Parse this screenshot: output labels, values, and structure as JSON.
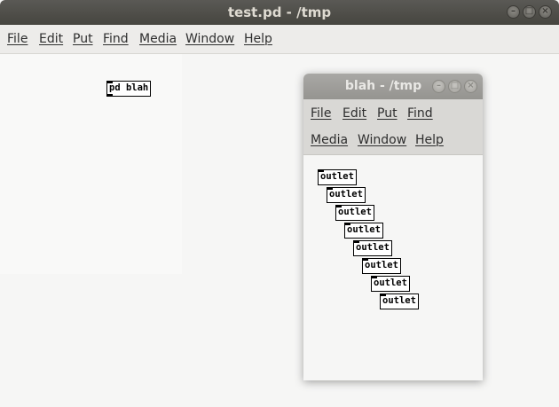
{
  "main_window": {
    "title": "test.pd  - /tmp",
    "controls": {
      "minimize": "–",
      "maximize": "□",
      "close": "×"
    },
    "menu": [
      "File",
      "Edit",
      "Put",
      "Find",
      "Media",
      "Window",
      "Help"
    ],
    "canvas": {
      "objects": [
        {
          "text": "pd blah"
        }
      ]
    }
  },
  "sub_window": {
    "title": "blah  - /tmp",
    "controls": {
      "minimize": "–",
      "maximize": "□",
      "close": "×"
    },
    "menu": [
      "File",
      "Edit",
      "Put",
      "Find",
      "Media",
      "Window",
      "Help"
    ],
    "canvas": {
      "objects": [
        {
          "text": "outlet"
        },
        {
          "text": "outlet"
        },
        {
          "text": "outlet"
        },
        {
          "text": "outlet"
        },
        {
          "text": "outlet"
        },
        {
          "text": "outlet"
        },
        {
          "text": "outlet"
        },
        {
          "text": "outlet"
        }
      ]
    }
  }
}
